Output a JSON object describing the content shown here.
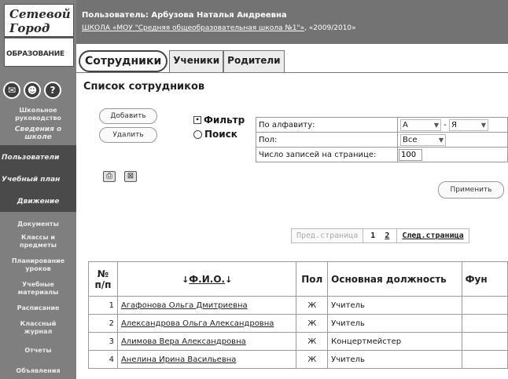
{
  "logo": {
    "line1": "Сетевой",
    "line2": "Город",
    "line3": "ОБРАЗОВАНИЕ"
  },
  "header": {
    "user": "Пользователь: Арбузова Наталья Андреевна",
    "school_link": "ШКОЛА «МОУ \"Средняя общеобразовательная школа №1\"»",
    "year": ", «2009/2010»"
  },
  "sidebar": {
    "icons": [
      "mail-icon",
      "people-icon",
      "help-icon"
    ],
    "items": [
      {
        "label": "Школьное руководство"
      },
      {
        "label": "Сведения о школе"
      },
      {
        "label": "Пользователи"
      },
      {
        "label": "Учебный план"
      },
      {
        "label": "Движение"
      },
      {
        "label": "Документы"
      },
      {
        "label": "Классы и предметы"
      },
      {
        "label": "Планирование уроков"
      },
      {
        "label": "Учебные материалы"
      },
      {
        "label": "Расписание"
      },
      {
        "label": "Классный журнал"
      },
      {
        "label": "Отчеты"
      },
      {
        "label": "Объявления"
      }
    ]
  },
  "tabs": [
    {
      "label": "Сотрудники"
    },
    {
      "label": "Ученики"
    },
    {
      "label": "Родители"
    }
  ],
  "page_title": "Список сотрудников",
  "buttons": {
    "add": "Добавить",
    "delete": "Удалить",
    "apply": "Применить"
  },
  "mode": {
    "filter": "Фильтр",
    "search": "Поиск",
    "selected": "filter"
  },
  "filter": {
    "alpha_label": "По алфавиту:",
    "alpha_from": "А",
    "alpha_to": "Я",
    "sex_label": "Пол:",
    "sex_value": "Все",
    "per_page_label": "Число записей на странице:",
    "per_page_value": "100"
  },
  "pager": {
    "prev": "Пред.страница",
    "page1": "1",
    "page2": "2",
    "next": "След.страница"
  },
  "table": {
    "headers": {
      "num": "№ п/п",
      "name": "Ф.И.О.",
      "sex": "Пол",
      "position": "Основная должность",
      "func": "Фун"
    },
    "rows": [
      {
        "n": "1",
        "name": "Агафонова Ольга Дмитриевна",
        "sex": "Ж",
        "position": "Учитель"
      },
      {
        "n": "2",
        "name": "Александрова Ольга Александровна",
        "sex": "Ж",
        "position": "Учитель"
      },
      {
        "n": "3",
        "name": "Алимова Вера Александровна",
        "sex": "Ж",
        "position": "Концертмейстер"
      },
      {
        "n": "4",
        "name": "Анелина Ирина Васильевна",
        "sex": "Ж",
        "position": "Учитель"
      }
    ]
  }
}
